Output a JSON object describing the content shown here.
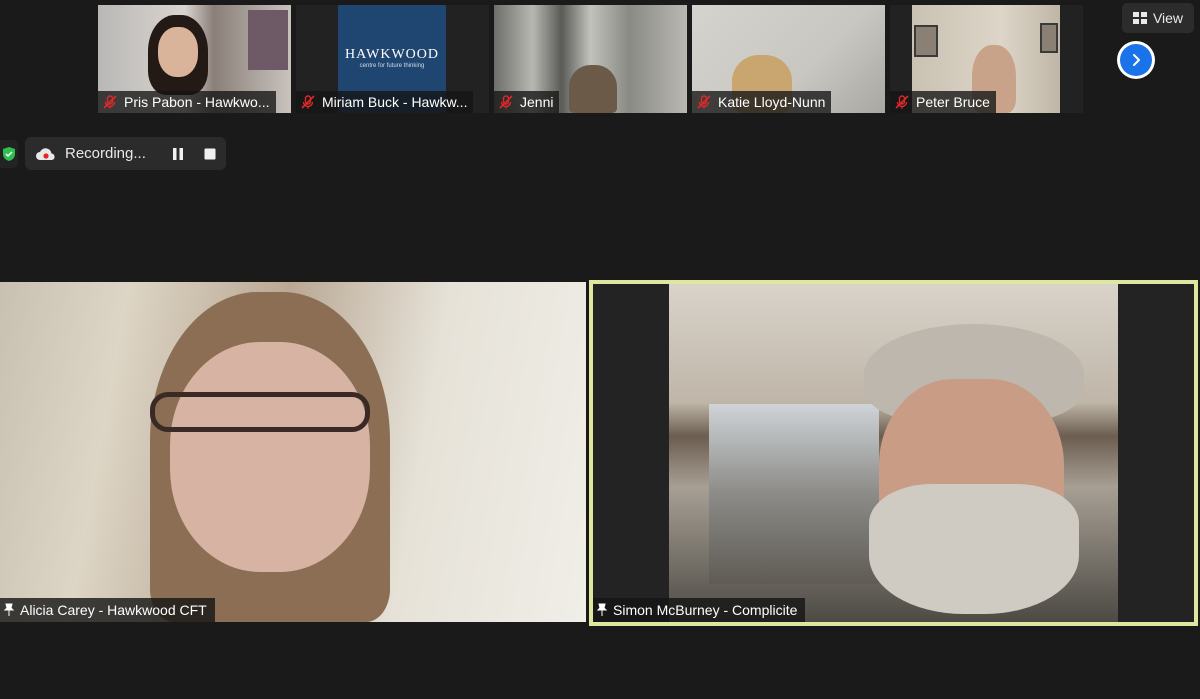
{
  "participants": [
    {
      "name": "Pris Pabon - Hawkwo...",
      "muted": true
    },
    {
      "name": "Miriam Buck - Hawkw...",
      "muted": true,
      "logo_title": "HAWKWOOD",
      "logo_sub": "centre for future thinking"
    },
    {
      "name": "Jenni",
      "muted": true
    },
    {
      "name": "Katie Lloyd-Nunn",
      "muted": true
    },
    {
      "name": "Peter Bruce",
      "muted": true
    }
  ],
  "view_button": {
    "label": "View",
    "icon": "grid-icon"
  },
  "next_page": {
    "icon": "chevron-right-icon"
  },
  "recording": {
    "label": "Recording...",
    "icon": "cloud-record-icon",
    "pause_icon": "pause-icon",
    "stop_icon": "stop-icon"
  },
  "security": {
    "icon": "shield-check-icon",
    "color": "#2fbf4f"
  },
  "main_speakers": [
    {
      "name": "Alicia Carey - Hawkwood CFT",
      "icon": "pin-icon"
    },
    {
      "name": "Simon McBurney - Complicite",
      "icon": "pin-icon",
      "active_speaker": true,
      "highlight_color": "#dfe6a0"
    }
  ],
  "colors": {
    "background": "#1a1a1a",
    "accent": "#1a73e8",
    "muted_icon": "#e02828",
    "recording_dot": "#e02828"
  }
}
